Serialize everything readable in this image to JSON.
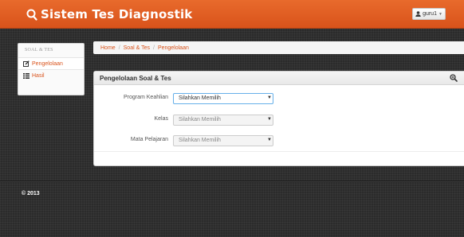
{
  "header": {
    "app_title": "Sistem Tes Diagnostik",
    "user_menu": {
      "username": "guru1",
      "icon": "user-icon"
    }
  },
  "sidebar": {
    "section_title": "SOAL & TES",
    "items": [
      {
        "label": "Pengelolaan",
        "icon": "edit-icon",
        "active": true
      },
      {
        "label": "Hasil",
        "icon": "list-icon",
        "active": false
      }
    ]
  },
  "breadcrumb": {
    "items": [
      "Home",
      "Soal & Tes",
      "Pengelolaan"
    ],
    "separator": "/"
  },
  "panel": {
    "title": "Pengelolaan Soal & Tes",
    "zoom_icon": "zoom-icon",
    "fields": [
      {
        "label": "Program Keahlian",
        "value": "Silahkan Memilih",
        "enabled": true
      },
      {
        "label": "Kelas",
        "value": "Silahkan Memilih",
        "enabled": false
      },
      {
        "label": "Mata Pelajaran",
        "value": "Silahkan Memilih",
        "enabled": false
      }
    ]
  },
  "footer": {
    "text": "© 2013"
  },
  "colors": {
    "brand": "#d9531b",
    "background": "#2b2b2b",
    "focus_border": "#66afe9"
  }
}
